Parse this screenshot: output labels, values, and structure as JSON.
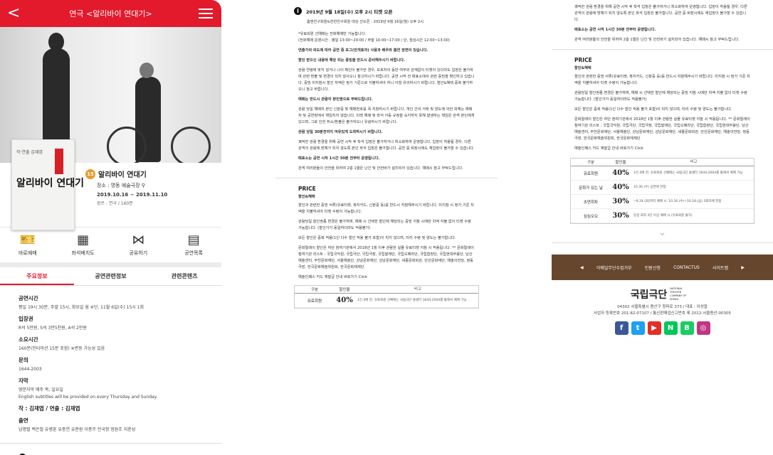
{
  "header": {
    "back": "<",
    "title": "연극 <알리바이 연대기>"
  },
  "show": {
    "poster_small": "작·연출 김재엽",
    "poster_title": "알리바이 연대기",
    "age_badge": "15",
    "title": "알리바이 연대기",
    "venue": "장소 : 명동 예술극장",
    "dates": "2019.10.16 ~ 2019.11.10",
    "genre": "장르 : 연극 / 160분"
  },
  "actions": [
    {
      "icon": "🎫",
      "label": "바로예매"
    },
    {
      "icon": "▦",
      "label": "좌석배치도"
    },
    {
      "icon": "⋈",
      "label": "공유하기"
    },
    {
      "icon": "▤",
      "label": "공연목록"
    }
  ],
  "tabs": [
    "주요정보",
    "공연관련정보",
    "관련콘텐츠"
  ],
  "info": [
    {
      "h": "공연시간",
      "v": "평일 19시 30분, 주말 15시, 화요일 쉼 ※단, 11월 6일(수) 15시 1회"
    },
    {
      "h": "입장권",
      "v": "R석 5만원, S석 3만5천원, A석 2만원"
    },
    {
      "h": "소요시간",
      "v": "160분(인터미션 15분 포함) ※변동 가능성 있음"
    },
    {
      "h": "문의",
      "v": "1644-2003"
    },
    {
      "h": "자막",
      "v": "영문자막 매주 목, 일요일"
    },
    {
      "h": "",
      "v": "English subtitles will be provided on every Thursday and Sunday."
    },
    {
      "h": "작 : 김재엽 / 연출 : 김재엽",
      "v": ""
    },
    {
      "h": "출연",
      "v": "남명렬 백은철 유병훈 유종연 유준원 이종무 전국향 정원조 지춘성"
    }
  ],
  "notice": {
    "head": "2019년 9월 18일(수) 오후 2시 티켓 오픈",
    "line1": "홈앤친구회원&천한친구회원 대상 선오픈 : 2019년 9월 16일(월) 오후 2시"
  },
  "col2": {
    "p1": "*유료회원 선예매는 전화예매만 가능합니다.",
    "p1b": "(전화예매 운영시간 : 평일 13:00~20:00 / 주말 10:00~17:00 / 단, 점심시간 12:00~13:00)",
    "p2": "연출가의 의도에 따라 공연 중 포그(안개효과) 사용과 배우와 흡연 장면이 있습니다.",
    "p3": "할인 받으신 내용에 해당 되는 증빙을 반드시 준비해주시기 바랍니다.",
    "p4": "관람 연령에 맞지 않거나 나이 확인이 불가한 경우, 보호자의 동반 여부와 관계없이 티켓이 있더라도 입장은 불가하며 관련 환불 및 변경이 되지 않사오니 참고하시기 바랍니다. 공연 시작 전 매표소에서 관련 증빙을 확인하고 있습니다. 증빙 미지참시 할인 차액은 정가 기준으로 지불하셔야 하니 이점 유의하시기 바랍니다. 할인&혜택 중복 불가하오니 참고 바랍니다.",
    "p5": "예매는 반드시 관람자 본인명으로 부탁드립니다.",
    "p6": "관람 당일 예매자 본인 신분증 및 예매번호를 꼭 지참하시기 바랍니다. 개인 간의 거래 및 양도에 의한 피해는 예매처 및 공연장에서 책임지지 않습니다. 티켓 예매 및 좌석 이동 규정을 숙지하지 못해 발생하는 책임은 관객 본인에게 있으며, 그로 인한 취소/환불은 불가하오니 유념하시기 바랍니다.",
    "p7": "관람 당일 30분전까지 여유있게 도착하시기 바랍니다.",
    "p8": "쾌적한 관람 환경을 위해 공연 시작 후 착석 입장은 불가하거나 최소화하여 운영합니다. 입장이 허용될 경우, 다른 관객의 관람에 방해가 되지 않도록 본인 좌석 입장은 불가합니다. 공연 중 퇴장시에도 재입장이 불가할 수 있습니다.",
    "p9": "매표소는 공연 시작 1시간 30분 전부터 운영됩니다.",
    "p10": "관객 여러분들의 안전을 위하여 2층 1열은 난간 및 안전바가 설치되어 있습니다. 예매시 참고 부탁드립니다.",
    "price_h": "PRICE",
    "price_sub": "할인&혜택",
    "price1": "할인과 관련한 증빙 서류(유료티켓, 복지카드, 신분증 등)를 반드시 지참해주시기 바랍니다. 미지참 시 정가 기준 차액을 지불하셔야 티켓 수령이 가능합니다.",
    "price2": "관람당일 할인권종 변경은 불가하며, 예매 시 선택한 할인에 해당되는 증빙 지참 시에만 차액 지불 없이 티켓 수령 가능합니다. (할인가가 동일하더라도 적용불가)",
    "price3": "모든 할인은 중복 적용(1인 다수 할인 적용 불가 포함)이 되지 않으며, 타리 수령 및 양도는 불가합니다.",
    "price4": "문화릴레이 할인은 하단 참여기관에서 2018년 1월 이후 관람한 실물 유료티켓 지참 시 적용됩니다. ** 문화릴레이 참여기관 리스트 : 국립국악원, 국립극단, 국립극장, 국립발레단, 국립오페라단, 국립합창단, 국립현대무용단, 남산예술센터, 부천문화재단, 서울예술단, 강남문화재단, 성남문화재단, 세종문화회관, 안산문화재단, 예술의전당, 정동극장, 한국문화예술위원회, 한국문화재재단",
    "price5": "예술인패스 카드 재발급 안내 바로가기 Click"
  },
  "price_table": {
    "headers": [
      "구분",
      "할인율",
      "비고"
    ],
    "rows": [
      {
        "a": "유료회원",
        "b": "40%",
        "c": "1인 4매 한, 유료회원 선예매는 국립극단 콜센터 1644-2004를 통해서 예매 가능"
      },
      {
        "a": "문화가 있는 날",
        "b": "40%",
        "c": "10.30.(수) 공연에 한함"
      },
      {
        "a": "초연회차",
        "b": "30%",
        "c": "~9.24.(화)까지 예매 시, 10.16.(수)~10.18.(금) 3회차에 한함"
      },
      {
        "a": "심심오오",
        "b": "30%",
        "c": "동일 회차 3인 이상 예매 시 (유료회원 불가)"
      }
    ]
  },
  "footer": {
    "links": [
      "이메일무단수집거부",
      "민원신청",
      "CONTACTUS",
      "사이트맵"
    ],
    "logo": "국립극단",
    "logo_sub": "NATIONAL THEATER COMPANY OF KOREA",
    "addr": "04302 서울특별시 용산구 청파로 373 / 대표 : 이성열",
    "biz": "사업자 등록번호 201-82-07107 / 통신판매업신고번호 제 2012-서울용산-00305",
    "social": [
      "f",
      "t",
      "▶",
      "N",
      "B",
      "◎"
    ]
  }
}
